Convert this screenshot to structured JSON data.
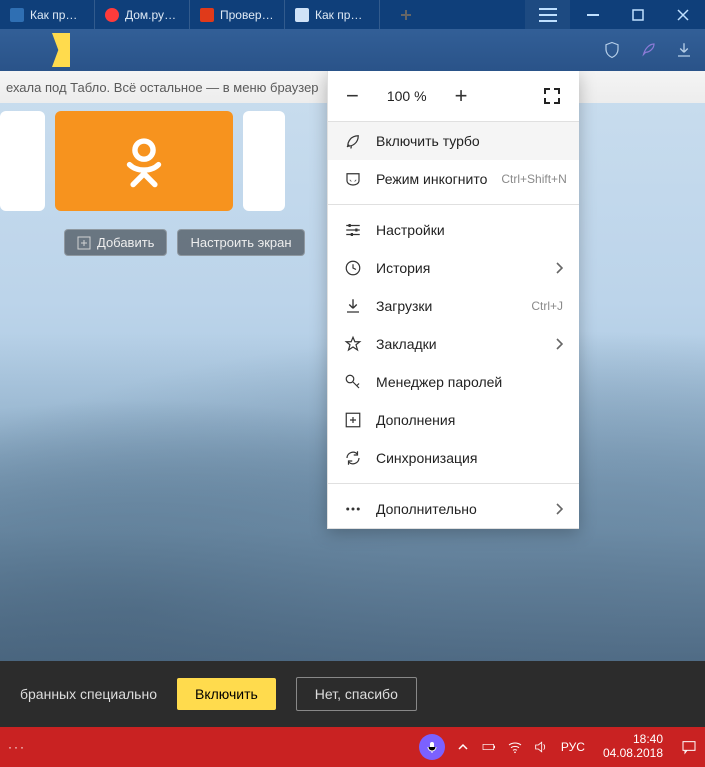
{
  "tabs": [
    {
      "title": "Как провер",
      "bg": "#2f6fb3"
    },
    {
      "title": "Дом.ру - к",
      "bg": "#ff3b3b"
    },
    {
      "title": "Проверить",
      "bg": "#e03a1a"
    },
    {
      "title": "Как провер",
      "bg": "#6ab0ff",
      "active": true
    }
  ],
  "tablo_text": "ехала под Табло. Всё остальное — в меню браузер",
  "add_btn": "Добавить",
  "configure_btn": "Настроить экран",
  "zoom": "100 %",
  "menu": {
    "turbo": "Включить турбо",
    "incognito": {
      "label": "Режим инкогнито",
      "shortcut": "Ctrl+Shift+N"
    },
    "settings": "Настройки",
    "history": "История",
    "downloads": {
      "label": "Загрузки",
      "shortcut": "Ctrl+J"
    },
    "bookmarks": "Закладки",
    "passwords": "Менеджер паролей",
    "addons": "Дополнения",
    "sync": "Синхронизация",
    "more": "Дополнительно"
  },
  "prompt": {
    "text": "бранных специально",
    "enable": "Включить",
    "decline": "Нет, спасибо"
  },
  "tray": {
    "lang": "РУС",
    "time": "18:40",
    "date": "04.08.2018"
  }
}
